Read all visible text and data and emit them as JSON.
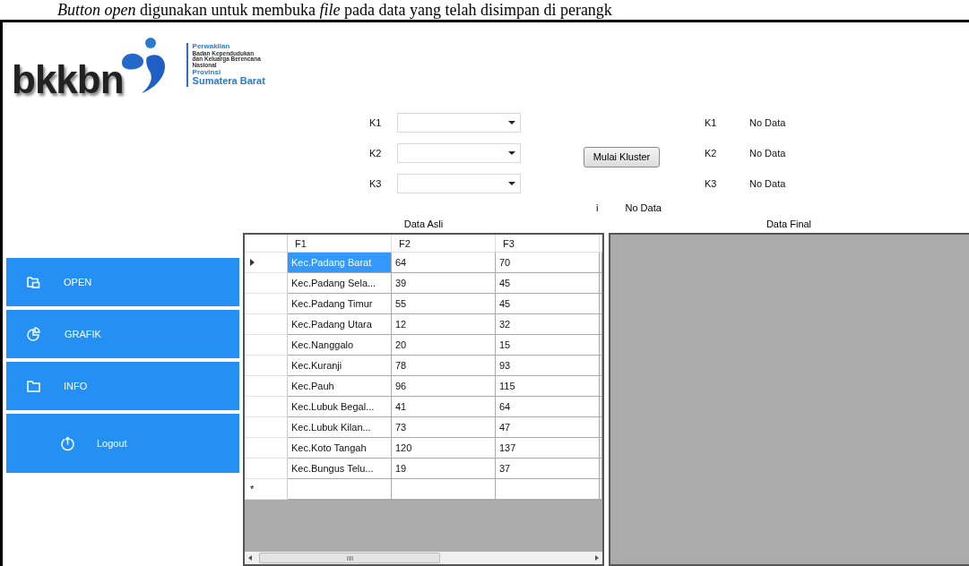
{
  "document_caption": "*Button open* digunakan untuk  membuka *file* pada data yang telah disimpan di perangk",
  "logo": {
    "wordmark": "bkkbn",
    "lines": [
      {
        "text": "Perwakilan",
        "kind": "accent"
      },
      {
        "text": "Badan Kependudukan",
        "kind": "plain"
      },
      {
        "text": "dan Keluarga Berencana",
        "kind": "plain"
      },
      {
        "text": "Nasional",
        "kind": "plain"
      },
      {
        "text": "Provinsi",
        "kind": "accent"
      },
      {
        "text": "Sumatera Barat",
        "kind": "title"
      }
    ]
  },
  "cluster_inputs": [
    {
      "label": "K1"
    },
    {
      "label": "K2"
    },
    {
      "label": "K3"
    }
  ],
  "start_button": "Mulai Kluster",
  "results": [
    {
      "label": "K1",
      "value": "No Data"
    },
    {
      "label": "K2",
      "value": "No Data"
    },
    {
      "label": "K3",
      "value": "No Data"
    }
  ],
  "iteration": {
    "label": "i",
    "value": "No Data"
  },
  "sidebar": [
    {
      "label": "OPEN",
      "kind": "open"
    },
    {
      "label": "GRAFIK",
      "kind": "chart"
    },
    {
      "label": "INFO",
      "kind": "folder"
    },
    {
      "label": "Logout",
      "kind": "logout"
    }
  ],
  "data_asli": {
    "title": "Data Asli",
    "columns": [
      "F1",
      "F2",
      "F3"
    ],
    "new_row_marker": "*",
    "rows": [
      {
        "cells": [
          "Kec.Padang Barat",
          "64",
          "70"
        ],
        "selected": true
      },
      {
        "cells": [
          "Kec.Padang Sela...",
          "39",
          "45"
        ],
        "selected": false
      },
      {
        "cells": [
          "Kec.Padang Timur",
          "55",
          "45"
        ],
        "selected": false
      },
      {
        "cells": [
          "Kec.Padang Utara",
          "12",
          "32"
        ],
        "selected": false
      },
      {
        "cells": [
          "Kec.Nanggalo",
          "20",
          "15"
        ],
        "selected": false
      },
      {
        "cells": [
          "Kec.Kuranji",
          "78",
          "93"
        ],
        "selected": false
      },
      {
        "cells": [
          "Kec.Pauh",
          "96",
          "115"
        ],
        "selected": false
      },
      {
        "cells": [
          "Kec.Lubuk Begal...",
          "41",
          "64"
        ],
        "selected": false
      },
      {
        "cells": [
          "Kec.Lubuk Kilan...",
          "73",
          "47"
        ],
        "selected": false
      },
      {
        "cells": [
          "Kec.Koto Tangah",
          "120",
          "137"
        ],
        "selected": false
      },
      {
        "cells": [
          "Kec.Bungus Telu...",
          "19",
          "37"
        ],
        "selected": false
      }
    ]
  },
  "data_final": {
    "title": "Data Final"
  }
}
